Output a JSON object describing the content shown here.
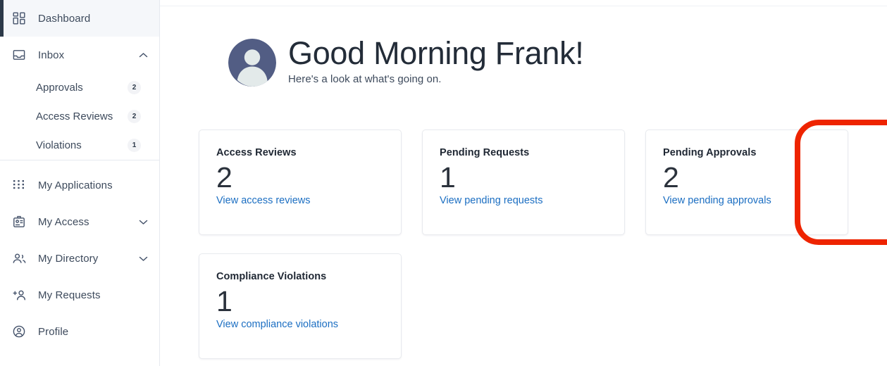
{
  "sidebar": {
    "primary_items": [
      {
        "id": "dashboard",
        "label": "Dashboard",
        "icon": "dashboard-grid-icon",
        "active": true,
        "expandable": false
      },
      {
        "id": "inbox",
        "label": "Inbox",
        "icon": "inbox-tray-icon",
        "active": false,
        "expandable": true,
        "chevron": "chevron-up-icon"
      }
    ],
    "inbox_children": [
      {
        "id": "approvals",
        "label": "Approvals",
        "badge": "2"
      },
      {
        "id": "access-reviews",
        "label": "Access Reviews",
        "badge": "2"
      },
      {
        "id": "violations",
        "label": "Violations",
        "badge": "1"
      }
    ],
    "secondary_items": [
      {
        "id": "my-applications",
        "label": "My Applications",
        "icon": "apps-dots-grid-icon",
        "expandable": false
      },
      {
        "id": "my-access",
        "label": "My Access",
        "icon": "id-badge-icon",
        "expandable": true,
        "chevron": "chevron-down-icon"
      },
      {
        "id": "my-directory",
        "label": "My Directory",
        "icon": "people-group-icon",
        "expandable": true,
        "chevron": "chevron-down-icon"
      },
      {
        "id": "my-requests",
        "label": "My Requests",
        "icon": "person-add-icon",
        "expandable": false
      },
      {
        "id": "profile",
        "label": "Profile",
        "icon": "user-circle-icon",
        "expandable": false
      }
    ],
    "active_indicator_color": "#2c3949",
    "active_background_color": "#f5f7fa"
  },
  "header": {
    "avatar": "default-user-avatar",
    "greeting": "Good Morning Frank!",
    "subtitle": "Here's a look at what's going on."
  },
  "cards": [
    {
      "id": "access-reviews",
      "title": "Access Reviews",
      "value": "2",
      "link": "View access reviews",
      "highlighted": false
    },
    {
      "id": "pending-requests",
      "title": "Pending Requests",
      "value": "1",
      "link": "View pending requests",
      "highlighted": false
    },
    {
      "id": "pending-approvals",
      "title": "Pending Approvals",
      "value": "2",
      "link": "View pending approvals",
      "highlighted": true
    },
    {
      "id": "compliance-violations",
      "title": "Compliance Violations",
      "value": "1",
      "link": "View compliance violations",
      "highlighted": false
    }
  ],
  "annotation": {
    "target": "pending-approvals-card",
    "shape": "rounded-rectangle-outline",
    "color": "#ee2400",
    "stroke_width_px": "8"
  },
  "colors": {
    "link": "#1b6ec2",
    "text_primary": "#232c38",
    "text_secondary": "#3d4a5c",
    "card_border": "#e8eaee",
    "annotation_red": "#ee2400",
    "avatar_bg": "#525d84"
  }
}
